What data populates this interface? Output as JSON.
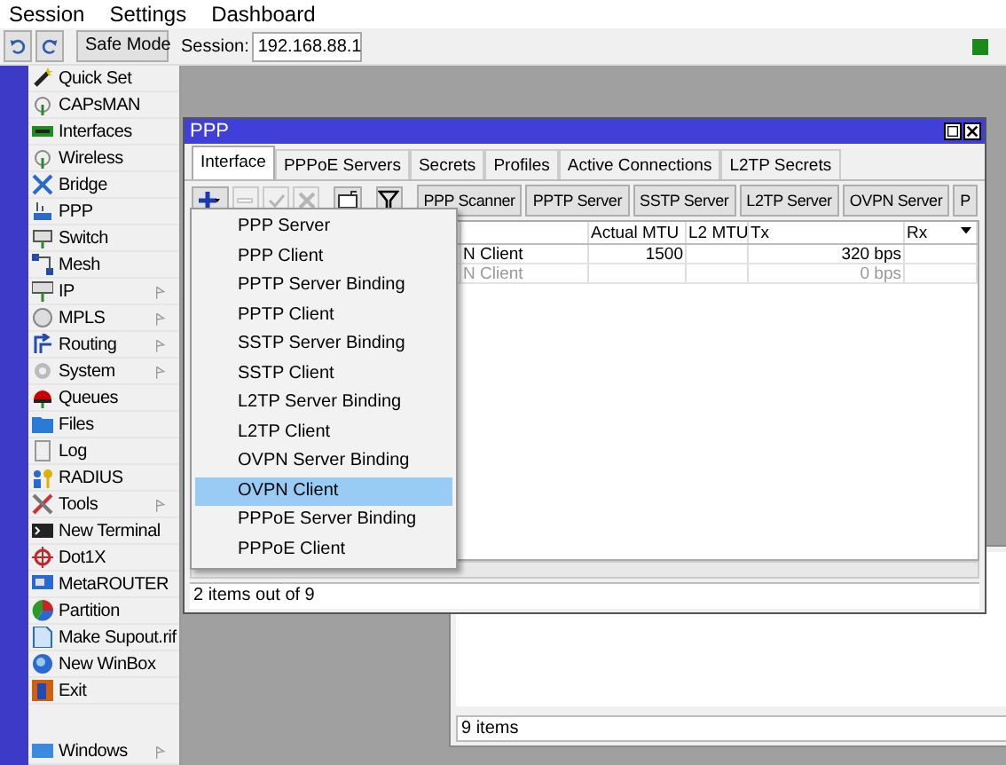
{
  "menu_bar": [
    "Session",
    "Settings",
    "Dashboard"
  ],
  "toolbar": {
    "safe_mode": "Safe Mode",
    "session_label": "Session:",
    "session_value": "192.168.88.1"
  },
  "sidebar": {
    "items": [
      {
        "label": "Quick Set",
        "submenu": false
      },
      {
        "label": "CAPsMAN",
        "submenu": false
      },
      {
        "label": "Interfaces",
        "submenu": false
      },
      {
        "label": "Wireless",
        "submenu": false
      },
      {
        "label": "Bridge",
        "submenu": false
      },
      {
        "label": "PPP",
        "submenu": false
      },
      {
        "label": "Switch",
        "submenu": false
      },
      {
        "label": "Mesh",
        "submenu": false
      },
      {
        "label": "IP",
        "submenu": true
      },
      {
        "label": "MPLS",
        "submenu": true
      },
      {
        "label": "Routing",
        "submenu": true
      },
      {
        "label": "System",
        "submenu": true
      },
      {
        "label": "Queues",
        "submenu": false
      },
      {
        "label": "Files",
        "submenu": false
      },
      {
        "label": "Log",
        "submenu": false
      },
      {
        "label": "RADIUS",
        "submenu": false
      },
      {
        "label": "Tools",
        "submenu": true
      },
      {
        "label": "New Terminal",
        "submenu": false
      },
      {
        "label": "Dot1X",
        "submenu": false
      },
      {
        "label": "MetaROUTER",
        "submenu": false
      },
      {
        "label": "Partition",
        "submenu": false
      },
      {
        "label": "Make Supout.rif",
        "submenu": false
      },
      {
        "label": "New WinBox",
        "submenu": false
      },
      {
        "label": "Exit",
        "submenu": false
      }
    ],
    "bottom_item": {
      "label": "Windows",
      "submenu": true
    }
  },
  "ppp_window": {
    "title": "PPP",
    "tabs": [
      {
        "label": "Interface",
        "selected": true
      },
      {
        "label": "PPPoE Servers",
        "selected": false
      },
      {
        "label": "Secrets",
        "selected": false
      },
      {
        "label": "Profiles",
        "selected": false
      },
      {
        "label": "Active Connections",
        "selected": false
      },
      {
        "label": "L2TP Secrets",
        "selected": false
      }
    ],
    "tool_icons": [
      {
        "kind": "add",
        "disabled": false
      },
      {
        "kind": "remove",
        "disabled": true
      },
      {
        "kind": "enable",
        "disabled": true
      },
      {
        "kind": "disable",
        "disabled": true
      },
      {
        "kind": "comment",
        "disabled": false
      },
      {
        "kind": "filter",
        "disabled": false
      }
    ],
    "tool_buttons": [
      "PPP Scanner",
      "PPTP Server",
      "SSTP Server",
      "L2TP Server",
      "OVPN Server",
      "P"
    ],
    "table": {
      "columns": [
        "",
        "Actual MTU",
        "L2 MTU",
        "Tx",
        "Rx"
      ],
      "rows": [
        {
          "cells": [
            "N Client",
            "1500",
            "",
            "320 bps",
            ""
          ],
          "disabled": false
        },
        {
          "cells": [
            "N Client",
            "",
            "",
            "0 bps",
            ""
          ],
          "disabled": true
        }
      ]
    },
    "status": "2 items out of 9"
  },
  "add_menu": {
    "items": [
      {
        "label": "PPP Server",
        "selected": false
      },
      {
        "label": "PPP Client",
        "selected": false
      },
      {
        "label": "PPTP Server Binding",
        "selected": false
      },
      {
        "label": "PPTP Client",
        "selected": false
      },
      {
        "label": "SSTP Server Binding",
        "selected": false
      },
      {
        "label": "SSTP Client",
        "selected": false
      },
      {
        "label": "L2TP Server Binding",
        "selected": false
      },
      {
        "label": "L2TP Client",
        "selected": false
      },
      {
        "label": "OVPN Server Binding",
        "selected": false
      },
      {
        "label": "OVPN Client",
        "selected": true
      },
      {
        "label": "PPPoE Server Binding",
        "selected": false
      },
      {
        "label": "PPPoE Client",
        "selected": false
      }
    ]
  },
  "back_window": {
    "status": "9 items"
  }
}
